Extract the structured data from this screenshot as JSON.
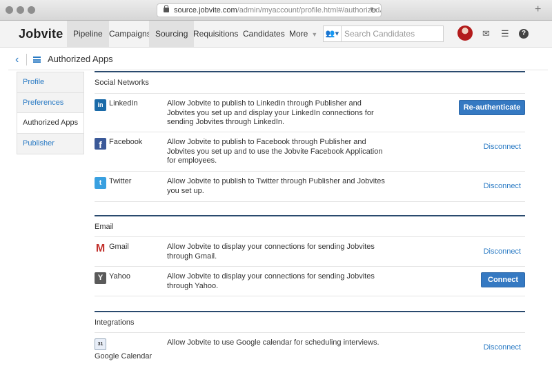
{
  "browser": {
    "url_host": "source.jobvite.com",
    "url_path": "/admin/myaccount/profile.html#/authorizedA",
    "plus": "+"
  },
  "nav": {
    "logo": "Jobvite",
    "items": [
      "Pipeline",
      "Campaigns",
      "Sourcing",
      "Requisitions",
      "Candidates",
      "More"
    ],
    "search_placeholder": "Search Candidates"
  },
  "page": {
    "title": "Authorized Apps"
  },
  "sidebar": {
    "items": [
      "Profile",
      "Preferences",
      "Authorized Apps",
      "Publisher"
    ],
    "active_index": 2
  },
  "sections": {
    "social": {
      "title": "Social Networks",
      "rows": [
        {
          "app": "LinkedIn",
          "icon": "linkedin-icon",
          "desc": "Allow Jobvite to publish to LinkedIn through Publisher and Jobvites you set up and display your LinkedIn connections for sending Jobvites through LinkedIn.",
          "action": "Re-authenticate",
          "action_type": "button"
        },
        {
          "app": "Facebook",
          "icon": "facebook-icon",
          "desc": "Allow Jobvite to publish to Facebook through Publisher and Jobvites you set up and to use the Jobvite Facebook Application for employees.",
          "action": "Disconnect",
          "action_type": "link"
        },
        {
          "app": "Twitter",
          "icon": "twitter-icon",
          "desc": "Allow Jobvite to publish to Twitter through Publisher and Jobvites you set up.",
          "action": "Disconnect",
          "action_type": "link"
        }
      ]
    },
    "email": {
      "title": "Email",
      "rows": [
        {
          "app": "Gmail",
          "icon": "gmail-icon",
          "desc": "Allow Jobvite to display your connections for sending Jobvites through Gmail.",
          "action": "Disconnect",
          "action_type": "link"
        },
        {
          "app": "Yahoo",
          "icon": "yahoo-icon",
          "desc": "Allow Jobvite to display your connections for sending Jobvites through Yahoo.",
          "action": "Connect",
          "action_type": "button"
        }
      ]
    },
    "integrations": {
      "title": "Integrations",
      "rows": [
        {
          "app": "Google Calendar",
          "icon": "google-calendar-icon",
          "desc": "Allow Jobvite to use Google calendar for scheduling interviews.",
          "action": "Disconnect",
          "action_type": "link"
        }
      ]
    }
  },
  "colors": {
    "accent": "#2b7bc4",
    "button": "#3579c2",
    "section_rule": "#2a4a6e"
  }
}
